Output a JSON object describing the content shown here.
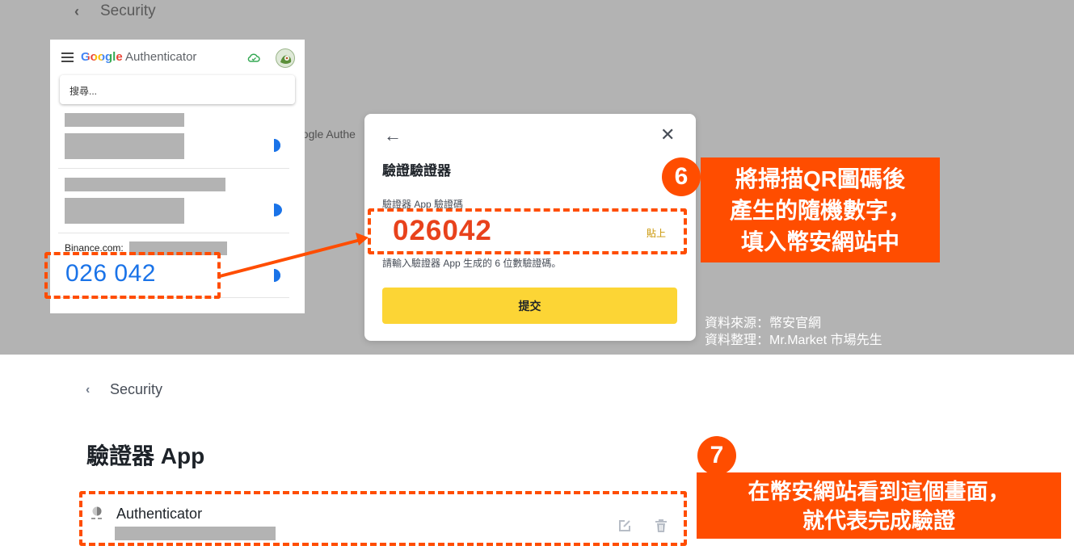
{
  "top": {
    "back_glyph": "‹",
    "title": "Security",
    "behind_text": "oogle Authe"
  },
  "google_authenticator": {
    "brand_g": "Google",
    "brand_auth": " Authenticator",
    "search_placeholder": "搜尋...",
    "account_label": "Binance.com:",
    "code": "026 042",
    "icons": [
      "menu-icon",
      "cloud-sync-icon",
      "avatar",
      "timer-pie-icon"
    ]
  },
  "verify_modal": {
    "back_glyph": "←",
    "close_glyph": "✕",
    "title": "驗證驗證器",
    "field_label": "驗證器 App 驗證碼",
    "code_value": "026042",
    "paste_label": "貼上",
    "hint": "請輸入驗證器 App 生成的 6 位數驗證碼。",
    "submit_label": "提交"
  },
  "source_note": {
    "line1": "資料來源：幣安官網",
    "line2": "資料整理：Mr.Market 市場先生"
  },
  "step6": {
    "number": "6",
    "line1": "將掃描QR圖碼後",
    "line2": "產生的隨機數字，",
    "line3": "填入幣安網站中"
  },
  "step7": {
    "number": "7",
    "line1": "在幣安網站看到這個畫面，",
    "line2": "就代表完成驗證"
  },
  "bottom": {
    "back_glyph": "‹",
    "breadcrumb": "Security",
    "heading": "驗證器 App",
    "authenticator_name": "Authenticator",
    "icons": [
      "authenticator-app-icon",
      "edit-icon",
      "trash-icon"
    ]
  },
  "colors": {
    "highlight": "#ff4d00",
    "binance_yellow": "#fcd535",
    "ga_blue": "#1a73e8",
    "code_orange": "#e8421c"
  }
}
